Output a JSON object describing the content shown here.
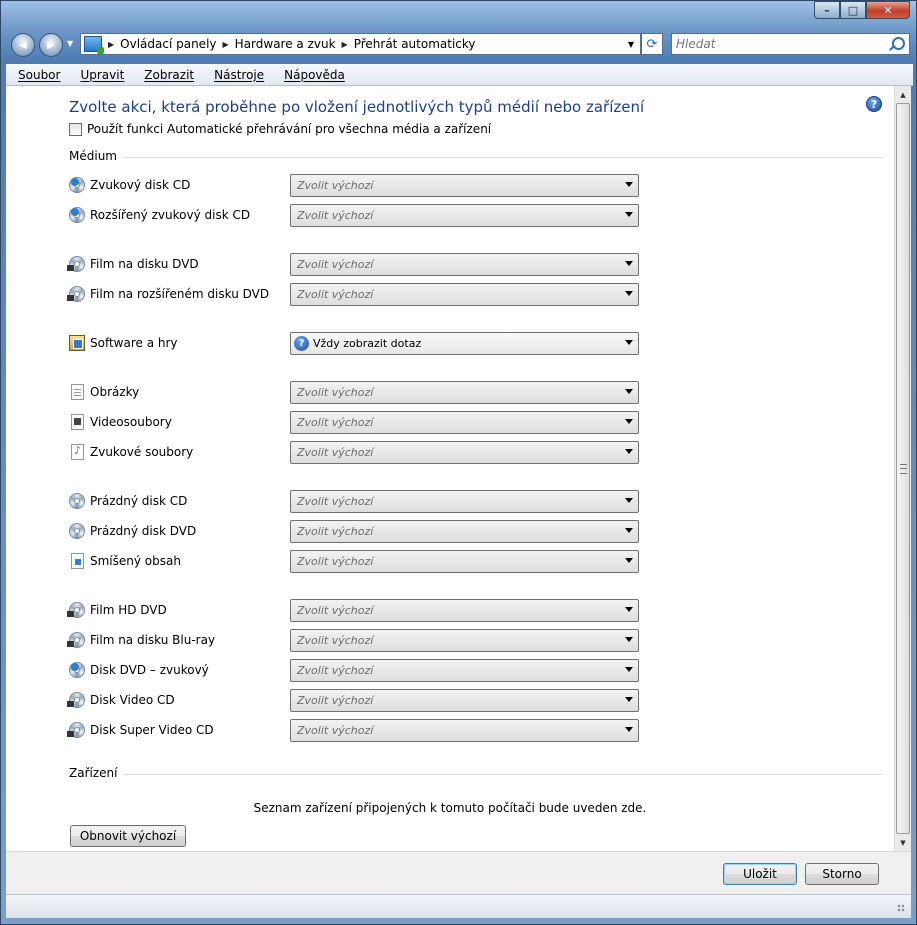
{
  "window": {
    "controls": {
      "minimize": "–",
      "maximize": "□",
      "close": "✕"
    }
  },
  "nav": {
    "back": "◀",
    "forward": "▶",
    "breadcrumb": [
      "Ovládací panely",
      "Hardware a zvuk",
      "Přehrát automaticky"
    ],
    "search_placeholder": "Hledat"
  },
  "menu": [
    "Soubor",
    "Upravit",
    "Zobrazit",
    "Nástroje",
    "Nápověda"
  ],
  "main": {
    "title": "Zvolte akci, která proběhne po vložení jednotlivých typů médií nebo zařízení",
    "checkbox_label": "Použít funkci Automatické přehrávání pro všechna média a zařízení",
    "checkbox_checked": false,
    "media_section": "Médium",
    "default_choice": "Zvolit výchozí",
    "media": [
      {
        "icon": "audio-cd-icon",
        "label": "Zvukový disk CD",
        "value": "Zvolit výchozí"
      },
      {
        "icon": "enhanced-audio-cd-icon",
        "label": "Rozšířený zvukový disk CD",
        "value": "Zvolit výchozí"
      },
      {
        "icon": "dvd-movie-icon",
        "label": "Film na disku DVD",
        "value": "Zvolit výchozí"
      },
      {
        "icon": "enhanced-dvd-movie-icon",
        "label": "Film na rozšířeném disku DVD",
        "value": "Zvolit výchozí"
      },
      {
        "icon": "software-games-icon",
        "label": "Software a hry",
        "value": "Vždy zobrazit dotaz"
      },
      {
        "icon": "pictures-icon",
        "label": "Obrázky",
        "value": "Zvolit výchozí"
      },
      {
        "icon": "video-files-icon",
        "label": "Videosoubory",
        "value": "Zvolit výchozí"
      },
      {
        "icon": "audio-files-icon",
        "label": "Zvukové soubory",
        "value": "Zvolit výchozí"
      },
      {
        "icon": "blank-cd-icon",
        "label": "Prázdný disk CD",
        "value": "Zvolit výchozí"
      },
      {
        "icon": "blank-dvd-icon",
        "label": "Prázdný disk DVD",
        "value": "Zvolit výchozí"
      },
      {
        "icon": "mixed-content-icon",
        "label": "Smíšený obsah",
        "value": "Zvolit výchozí"
      },
      {
        "icon": "hd-dvd-icon",
        "label": "Film HD DVD",
        "value": "Zvolit výchozí"
      },
      {
        "icon": "bluray-icon",
        "label": "Film na disku Blu-ray",
        "value": "Zvolit výchozí"
      },
      {
        "icon": "dvd-audio-icon",
        "label": "Disk DVD – zvukový",
        "value": "Zvolit výchozí"
      },
      {
        "icon": "video-cd-icon",
        "label": "Disk Video CD",
        "value": "Zvolit výchozí"
      },
      {
        "icon": "super-video-cd-icon",
        "label": "Disk Super Video CD",
        "value": "Zvolit výchozí"
      }
    ],
    "devices_section": "Zařízení",
    "devices_message": "Seznam zařízení připojených k tomuto počítači bude uveden zde.",
    "reset_button": "Obnovit výchozí"
  },
  "footer": {
    "save": "Uložit",
    "cancel": "Storno"
  }
}
